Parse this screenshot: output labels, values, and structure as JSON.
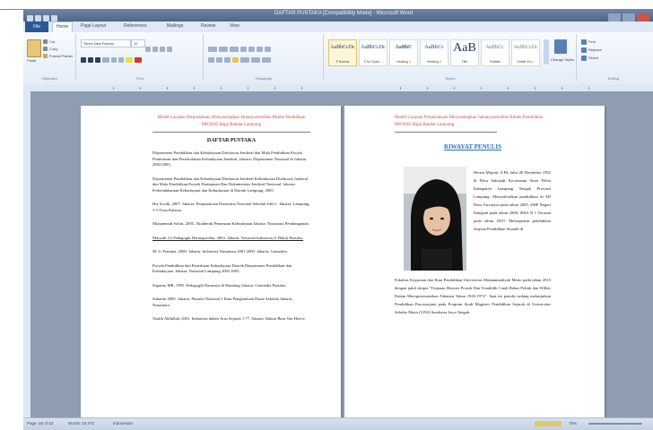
{
  "window": {
    "title": "DAFTAR PUSTAKA [Compatibility Mode] - Microsoft Word"
  },
  "tabs": [
    "File",
    "Home",
    "Page Layout",
    "References",
    "Mailings",
    "Review",
    "View"
  ],
  "ribbon": {
    "clipboard": {
      "paste": "Paste",
      "cut": "Cut",
      "copy": "Copy",
      "format_painter": "Format Painter",
      "label": "Clipboard"
    },
    "font": {
      "name": "Times New Roman",
      "size": "12",
      "label": "Font"
    },
    "paragraph": {
      "label": "Paragraph"
    },
    "styles": {
      "label": "Styles",
      "items": [
        {
          "sample": "AaBbCcDc",
          "name": "¶ Normal"
        },
        {
          "sample": "AaBbCcDc",
          "name": "¶ No Spaci..."
        },
        {
          "sample": "AaBbC",
          "name": "Heading 1"
        },
        {
          "sample": "AaBbCc",
          "name": "Heading 2"
        },
        {
          "sample": "AaB",
          "name": "Title"
        },
        {
          "sample": "AaBbCc.",
          "name": "Subtitle"
        },
        {
          "sample": "AaBbCcDc",
          "name": "Subtle Em..."
        }
      ],
      "change_styles": "Change Styles"
    },
    "editing": {
      "find": "Find",
      "replace": "Replace",
      "select": "Select",
      "label": "Editing"
    }
  },
  "left_page": {
    "header": "Model Layanan Perpustakaan Menyenangkan Jamanyaresolitas Bimbe Pendidikan PROSSE Bajaj Bandar Lampung",
    "title": "DAFTAR PUSTAKA",
    "references": [
      "Departemen Pendidikan dan Kebudayaan Direktorat Jenderal dan Mala Pendidikan Proyek Pembinaan dan Persekolahan Kebudayaan Jenderal. Jakarta: Departemen Nasional di Jakarta, 2002/2003.",
      "Departemen Pendidikan dan Kebudayaan Direktorat Jenderal Kebudayaan Direktorat Jenderal dan Mala Pendidikan Proyek Peninjauan Dan Dokumentasi Jenderal Nasional. Jakarta: Perbendaharaan Kebudayaan dan Kebudayaan di Daerah Lampung, 2005.",
      "Hiz Swalk, 2007. Jakarta: Perpustakaan Pasiwamo Nasional Sekolah Jilid 1. Jakarta: Lampung, 3-5 Nosa Kalsian.",
      "Muhammad Sobiri, 2005. Akademik Penamaan Kebudayaan Jakarta: Nusantara Pembangunan.",
      "Maryadi (1) Pedagogik Hermaprodita, 2004. Jakarta: Nasional Indonesia (1 Buku) Pustaka.",
      "M. S. Pratama, 2000. Jakarta: Indonesia Nusantara 2001 2000. Jakarta: Gramedia.",
      "Proyek Pendidikan dan Penerbitan Kebudayaan Daerah Departemen Pendidikan dan Kebudayaan. Jakarta: Nasional Lampung 2003 2005.",
      "Suparno MR, 1995. Pedagogik Dasarnya di Bandung Jakarta: Gramedia Pustaka.",
      "Suharno 2005. Jakarta: Pustaka Nasional 1 Ilmu Pengetahuan Dasar Sekolah Jakarta: Nusantara.",
      "Taufik Abdullah, 2001. Indonesia dalam Arus Sejarah 1-77. Jakarta: Ikhtiar Baru Van Hoeve."
    ]
  },
  "right_page": {
    "header": "Model Layanan Perpustakaan Menyenangkan Jamanyaresolitas Bimbe Pendidikan PROSSE Bajaj Bandar Lampung",
    "title": "RIWAYAT PENULIS",
    "bio_paragraphs": [
      "Heriza Mujiati, S.Pd, lahir 20 Desember 1992 di Desa Sukajadi Kecamatan Sinar Pelita Kabupaten Lampung Tengah Provinsi Lampung. Menyelesaikan pendidikan di SD Desa Ariwijaya pada tahun 2005, SMP Negeri Sukajadi pada tahun 2008, SMA N 1 Terusan pada tahun 2010. Melanjutkan pendidikan Sarjana Pendidikan Sejarah di",
      "Fakultas Keguruan dan Ilmu Pendidikan Universitas Muhammadiyah Metro pada tahun 2015 dengan judul skripsi \"Tinjauan Historis Proyek Dan Trandidik Candi Bebas Politik dan Wilher Dalam Merepresentasikan Tahanan Tahun 1945-1974\". Saat ini penulis sedang melanjutkan Pendidikan Pascasarjana pada Program Studi Magister Pendidikan Sejarah di Universitas Sebelas Maret (UNS) Surakarta Jawa Tengah."
    ]
  },
  "status": {
    "page": "Page: 48 of 53",
    "words": "Words: 10,472",
    "language": "Indonesian",
    "zoom": "70%"
  }
}
